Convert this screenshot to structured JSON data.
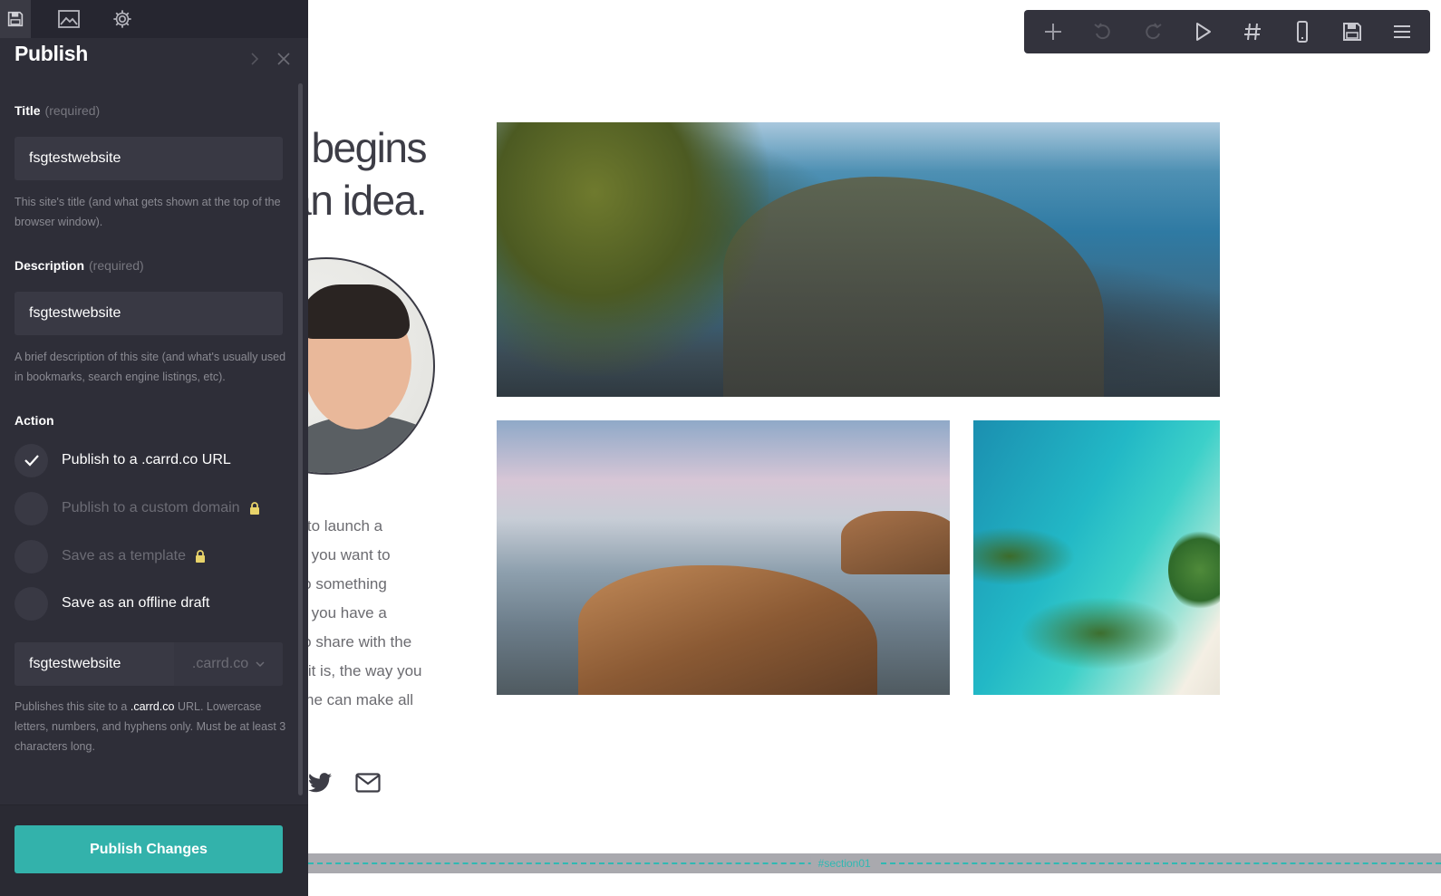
{
  "canvas": {
    "headline_line1": "begins",
    "headline_line2": "an idea.",
    "body_lines": [
      "nt to launch a",
      "be you want to",
      "nto something",
      "be you have a",
      "t to share with the",
      "er it is, the way you",
      "nline can make all"
    ],
    "section_label": "#section01"
  },
  "toolbar": {
    "icons": [
      "plus-icon",
      "undo-icon",
      "redo-icon",
      "play-icon",
      "hash-icon",
      "mobile-icon",
      "save-icon",
      "menu-icon"
    ]
  },
  "panel": {
    "tabs": [
      "save-icon",
      "image-icon",
      "gear-icon"
    ],
    "title": "Publish",
    "title_field": {
      "label": "Title",
      "required": "(required)",
      "value": "fsgtestwebsite",
      "help": "This site's title (and what gets shown at the top of the browser window)."
    },
    "description_field": {
      "label": "Description",
      "required": "(required)",
      "value": "fsgtestwebsite",
      "help": "A brief description of this site (and what's usually used in bookmarks, search engine listings, etc)."
    },
    "action": {
      "label": "Action",
      "options": [
        {
          "pre": "Publish to a ",
          "highlight": ".carrd.co",
          "post": " URL",
          "selected": true,
          "locked": false
        },
        {
          "pre": "Publish to a custom domain",
          "highlight": "",
          "post": "",
          "selected": false,
          "locked": true
        },
        {
          "pre": "Save as a template",
          "highlight": "",
          "post": "",
          "selected": false,
          "locked": true
        },
        {
          "pre": "Save as an ",
          "highlight": "offline",
          "post": " draft",
          "selected": false,
          "locked": false
        }
      ]
    },
    "url": {
      "value": "fsgtestwebsite",
      "domain": ".carrd.co",
      "help_pre": "Publishes this site to a ",
      "help_highlight": ".carrd.co",
      "help_post": " URL. Lowercase letters, numbers, and hyphens only. Must be at least 3 characters long."
    },
    "publish_button": "Publish Changes"
  },
  "colors": {
    "panel_bg": "#2e2e38",
    "accent": "#33b2ab",
    "toolbar_bg": "#33333d",
    "lock": "#e8d36a"
  }
}
